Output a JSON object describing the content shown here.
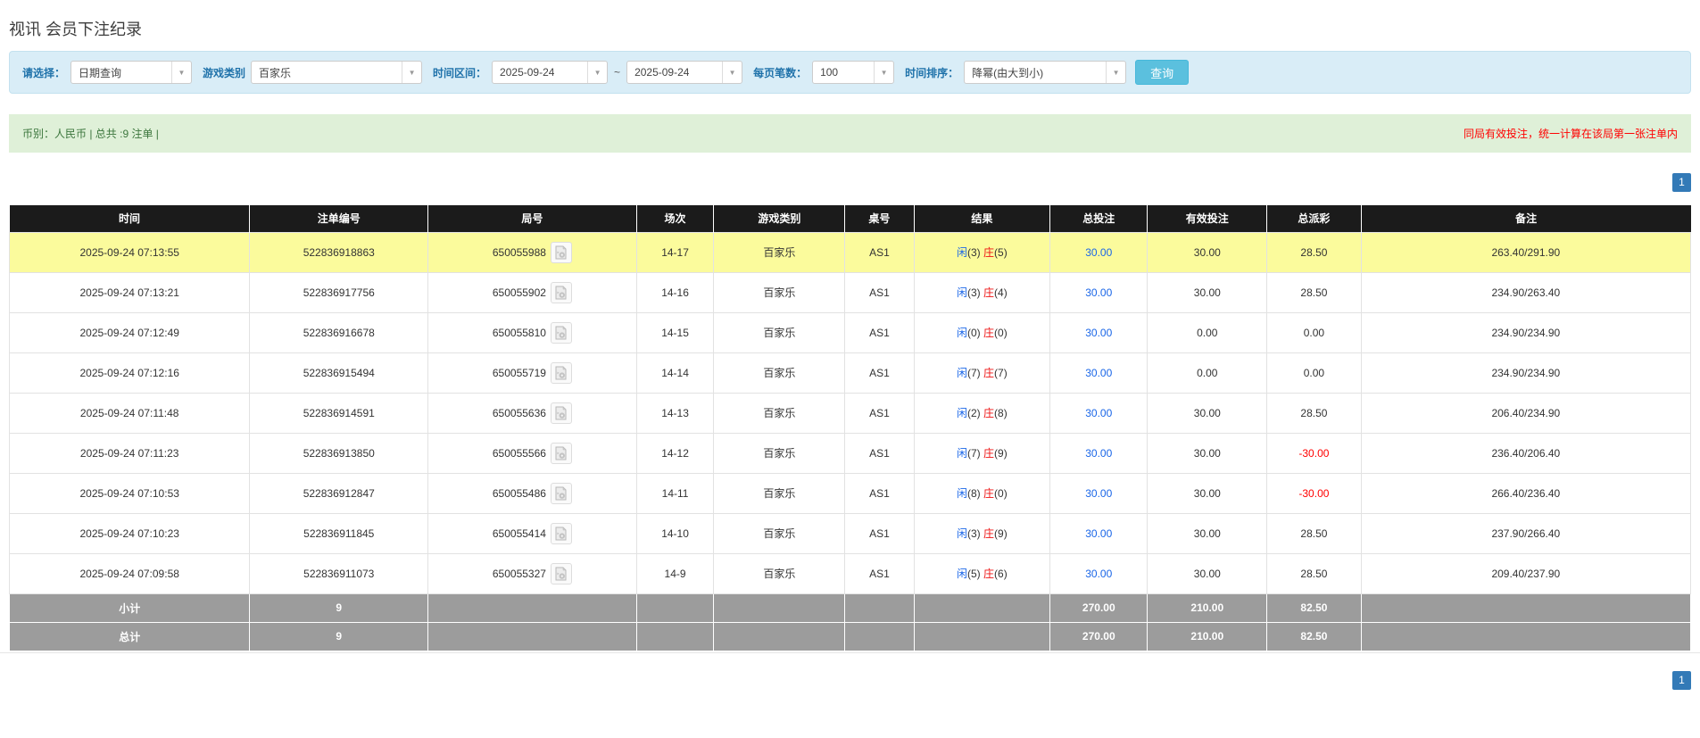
{
  "page_title": "视讯 会员下注纪录",
  "filter_bar": {
    "select_label": "请选择：",
    "query_type_value": "日期查询",
    "game_type_label": "游戏类别",
    "game_type_value": "百家乐",
    "time_range_label": "时间区间：",
    "date_from": "2025-09-24",
    "range_separator": "~",
    "date_to": "2025-09-24",
    "page_size_label": "每页笔数：",
    "page_size_value": "100",
    "time_sort_label": "时间排序：",
    "time_sort_value": "降幂(由大到小)",
    "search_button": "查询"
  },
  "summary_bar": {
    "currency_info": "币别：人民币 | 总共 :9 注单 |",
    "notice": "同局有效投注，统一计算在该局第一张注单内"
  },
  "pagination": {
    "page": "1"
  },
  "icons": {
    "dropdown": "chevron-down-icon",
    "video": "video-icon"
  },
  "colors": {
    "header_bg": "#1b1b1b",
    "highlight_yellow": "#fbfb9c",
    "player_blue": "#1a66e8",
    "banker_red": "#ee1111",
    "negative_red": "#ff0000",
    "pager_blue": "#337ab7",
    "search_button_bg": "#5bc0de",
    "filter_bar_bg": "#d9edf7",
    "summary_bar_bg": "#dff0d8",
    "subtotal_bg": "#9c9c9c"
  },
  "table": {
    "columns": [
      "时间",
      "注单编号",
      "局号",
      "场次",
      "游戏类别",
      "桌号",
      "结果",
      "总投注",
      "有效投注",
      "总派彩",
      "备注"
    ],
    "rows": [
      {
        "time": "2025-09-24 07:13:55",
        "bet_id": "522836918863",
        "round_id": "650055988",
        "session": "14-17",
        "game": "百家乐",
        "table_no": "AS1",
        "result": {
          "player_label": "闲",
          "player_score": "(3)",
          "banker_label": "庄",
          "banker_score": "(5)"
        },
        "total_bet": "30.00",
        "valid_bet": "30.00",
        "payout": "28.50",
        "remark": "263.40/291.90",
        "highlight": true
      },
      {
        "time": "2025-09-24 07:13:21",
        "bet_id": "522836917756",
        "round_id": "650055902",
        "session": "14-16",
        "game": "百家乐",
        "table_no": "AS1",
        "result": {
          "player_label": "闲",
          "player_score": "(3)",
          "banker_label": "庄",
          "banker_score": "(4)"
        },
        "total_bet": "30.00",
        "valid_bet": "30.00",
        "payout": "28.50",
        "remark": "234.90/263.40",
        "highlight": false
      },
      {
        "time": "2025-09-24 07:12:49",
        "bet_id": "522836916678",
        "round_id": "650055810",
        "session": "14-15",
        "game": "百家乐",
        "table_no": "AS1",
        "result": {
          "player_label": "闲",
          "player_score": "(0)",
          "banker_label": "庄",
          "banker_score": "(0)"
        },
        "total_bet": "30.00",
        "valid_bet": "0.00",
        "payout": "0.00",
        "remark": "234.90/234.90",
        "highlight": false
      },
      {
        "time": "2025-09-24 07:12:16",
        "bet_id": "522836915494",
        "round_id": "650055719",
        "session": "14-14",
        "game": "百家乐",
        "table_no": "AS1",
        "result": {
          "player_label": "闲",
          "player_score": "(7)",
          "banker_label": "庄",
          "banker_score": "(7)"
        },
        "total_bet": "30.00",
        "valid_bet": "0.00",
        "payout": "0.00",
        "remark": "234.90/234.90",
        "highlight": false
      },
      {
        "time": "2025-09-24 07:11:48",
        "bet_id": "522836914591",
        "round_id": "650055636",
        "session": "14-13",
        "game": "百家乐",
        "table_no": "AS1",
        "result": {
          "player_label": "闲",
          "player_score": "(2)",
          "banker_label": "庄",
          "banker_score": "(8)"
        },
        "total_bet": "30.00",
        "valid_bet": "30.00",
        "payout": "28.50",
        "remark": "206.40/234.90",
        "highlight": false
      },
      {
        "time": "2025-09-24 07:11:23",
        "bet_id": "522836913850",
        "round_id": "650055566",
        "session": "14-12",
        "game": "百家乐",
        "table_no": "AS1",
        "result": {
          "player_label": "闲",
          "player_score": "(7)",
          "banker_label": "庄",
          "banker_score": "(9)"
        },
        "total_bet": "30.00",
        "valid_bet": "30.00",
        "payout": "-30.00",
        "remark": "236.40/206.40",
        "highlight": false
      },
      {
        "time": "2025-09-24 07:10:53",
        "bet_id": "522836912847",
        "round_id": "650055486",
        "session": "14-11",
        "game": "百家乐",
        "table_no": "AS1",
        "result": {
          "player_label": "闲",
          "player_score": "(8)",
          "banker_label": "庄",
          "banker_score": "(0)"
        },
        "total_bet": "30.00",
        "valid_bet": "30.00",
        "payout": "-30.00",
        "remark": "266.40/236.40",
        "highlight": false
      },
      {
        "time": "2025-09-24 07:10:23",
        "bet_id": "522836911845",
        "round_id": "650055414",
        "session": "14-10",
        "game": "百家乐",
        "table_no": "AS1",
        "result": {
          "player_label": "闲",
          "player_score": "(3)",
          "banker_label": "庄",
          "banker_score": "(9)"
        },
        "total_bet": "30.00",
        "valid_bet": "30.00",
        "payout": "28.50",
        "remark": "237.90/266.40",
        "highlight": false
      },
      {
        "time": "2025-09-24 07:09:58",
        "bet_id": "522836911073",
        "round_id": "650055327",
        "session": "14-9",
        "game": "百家乐",
        "table_no": "AS1",
        "result": {
          "player_label": "闲",
          "player_score": "(5)",
          "banker_label": "庄",
          "banker_score": "(6)"
        },
        "total_bet": "30.00",
        "valid_bet": "30.00",
        "payout": "28.50",
        "remark": "209.40/237.90",
        "highlight": false
      }
    ],
    "subtotal": {
      "label": "小计",
      "count": "9",
      "total_bet": "270.00",
      "valid_bet": "210.00",
      "payout": "82.50"
    },
    "total": {
      "label": "总计",
      "count": "9",
      "total_bet": "270.00",
      "valid_bet": "210.00",
      "payout": "82.50"
    }
  }
}
